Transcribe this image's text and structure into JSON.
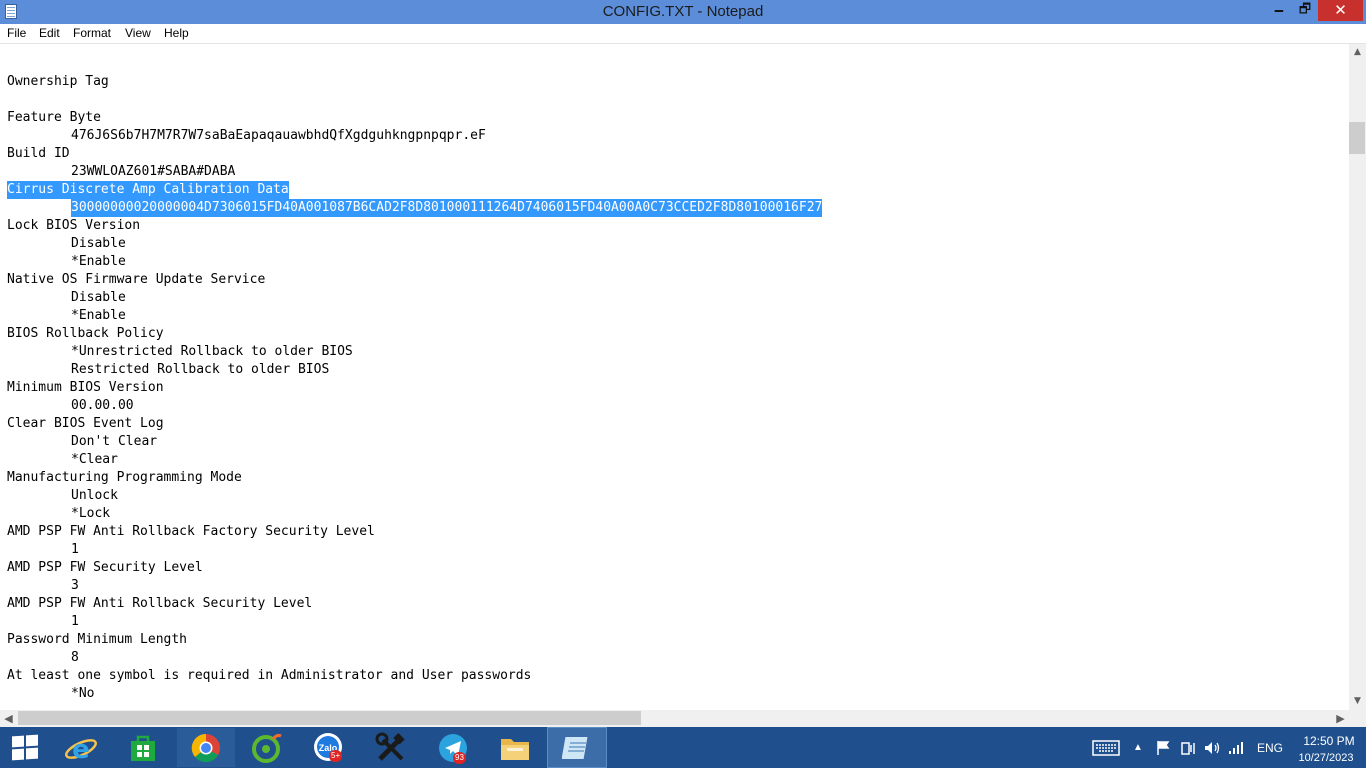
{
  "window": {
    "title": "CONFIG.TXT - Notepad",
    "controls": {
      "minimize": "🗕",
      "maximize": "🗗",
      "close": "✕"
    }
  },
  "menu": [
    "File",
    "Edit",
    "Format",
    "View",
    "Help"
  ],
  "document": {
    "lines": [
      "",
      "Ownership Tag",
      "",
      "Feature Byte",
      "476J6S6b7H7M7R7W7saBaEapaqauawbhdQfXgdguhkngpnpqpr.eF",
      "Build ID",
      "23WWLOAZ601#SABA#DABA",
      "Cirrus Discrete Amp Calibration Data",
      "30000000020000004D7306015FD40A001087B6CAD2F8D801000111264D7406015FD40A00A0C73CCED2F8D80100016F27",
      "Lock BIOS Version",
      "Disable",
      "*Enable",
      "Native OS Firmware Update Service",
      "Disable",
      "*Enable",
      "BIOS Rollback Policy",
      "*Unrestricted Rollback to older BIOS",
      "Restricted Rollback to older BIOS",
      "Minimum BIOS Version",
      "00.00.00",
      "Clear BIOS Event Log",
      "Don't Clear",
      "*Clear",
      "Manufacturing Programming Mode",
      "Unlock",
      "*Lock",
      "AMD PSP FW Anti Rollback Factory Security Level",
      "1",
      "AMD PSP FW Security Level",
      "3",
      "AMD PSP FW Anti Rollback Security Level",
      "1",
      "Password Minimum Length",
      "8",
      "At least one symbol is required in Administrator and User passwords",
      "*No"
    ],
    "indented": [
      4,
      6,
      8,
      10,
      11,
      13,
      14,
      16,
      17,
      19,
      21,
      22,
      24,
      25,
      27,
      29,
      31,
      33,
      35
    ],
    "selected_lines": [
      7,
      8
    ]
  },
  "taskbar": {
    "apps": [
      {
        "name": "internet-explorer",
        "badge": ""
      },
      {
        "name": "windows-store",
        "badge": ""
      },
      {
        "name": "chrome",
        "badge": ""
      },
      {
        "name": "coccoc-browser",
        "badge": ""
      },
      {
        "name": "zalo",
        "label": "Zalo",
        "badge": "5+"
      },
      {
        "name": "tools",
        "badge": ""
      },
      {
        "name": "telegram",
        "badge": "93"
      },
      {
        "name": "file-explorer",
        "badge": ""
      },
      {
        "name": "notepad",
        "badge": ""
      }
    ],
    "active_app": "notepad",
    "language": "ENG",
    "clock_time": "12:50 PM",
    "clock_date": "10/27/2023"
  },
  "colors": {
    "titlebar": "#5b8dd9",
    "selection": "#3399ff",
    "taskbar": "#1f4f8c",
    "close_button": "#c7302c"
  }
}
